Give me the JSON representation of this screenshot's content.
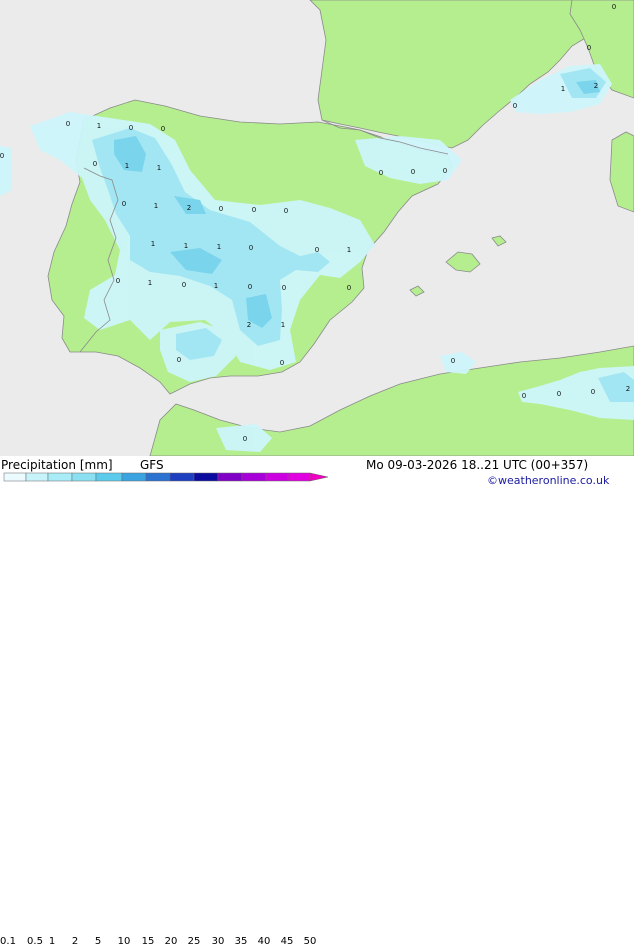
{
  "product": {
    "title": "Precipitation [mm]",
    "model": "GFS",
    "valid_time": "Mo 09-03-2026 18..21 UTC (00+357)",
    "credit": "©weatheronline.co.uk"
  },
  "legend": {
    "ticks": [
      "0.1",
      "0.5",
      "1",
      "2",
      "5",
      "10",
      "15",
      "20",
      "25",
      "30",
      "35",
      "40",
      "45",
      "50"
    ],
    "colors": [
      "#ecfbff",
      "#c8f3fb",
      "#a8ecf7",
      "#8ae0f0",
      "#5ccbeb",
      "#3aa3e0",
      "#2c72d0",
      "#1e3fbf",
      "#0c0c9e",
      "#8000c8",
      "#a800d8",
      "#cc00e0",
      "#e000e0",
      "#f000c0"
    ]
  },
  "map": {
    "colors": {
      "sea": "#ebebeb",
      "land": "#b5ee8e",
      "precip_light": "#cdf6fb",
      "precip_mid": "#a3e6f3",
      "precip_heavy": "#7ad4ec"
    },
    "values": [
      {
        "t": "0"
      },
      {
        "t": "1"
      },
      {
        "t": "0"
      },
      {
        "t": "0"
      },
      {
        "t": "0"
      },
      {
        "t": "0"
      },
      {
        "t": "1"
      },
      {
        "t": "1"
      },
      {
        "t": "0"
      },
      {
        "t": "1"
      },
      {
        "t": "2"
      },
      {
        "t": "0"
      },
      {
        "t": "0"
      },
      {
        "t": "0"
      },
      {
        "t": "1"
      },
      {
        "t": "1"
      },
      {
        "t": "1"
      },
      {
        "t": "0"
      },
      {
        "t": "0"
      },
      {
        "t": "1"
      },
      {
        "t": "0"
      },
      {
        "t": "1"
      },
      {
        "t": "0"
      },
      {
        "t": "1"
      },
      {
        "t": "0"
      },
      {
        "t": "0"
      },
      {
        "t": "2"
      },
      {
        "t": "1"
      },
      {
        "t": "0"
      },
      {
        "t": "0"
      },
      {
        "t": "0"
      },
      {
        "t": "0"
      },
      {
        "t": "0"
      },
      {
        "t": "0"
      },
      {
        "t": "0"
      },
      {
        "t": "0"
      },
      {
        "t": "1"
      },
      {
        "t": "2"
      },
      {
        "t": "0"
      },
      {
        "t": "0"
      },
      {
        "t": "0"
      },
      {
        "t": "0"
      },
      {
        "t": "0"
      },
      {
        "t": "2"
      }
    ]
  }
}
